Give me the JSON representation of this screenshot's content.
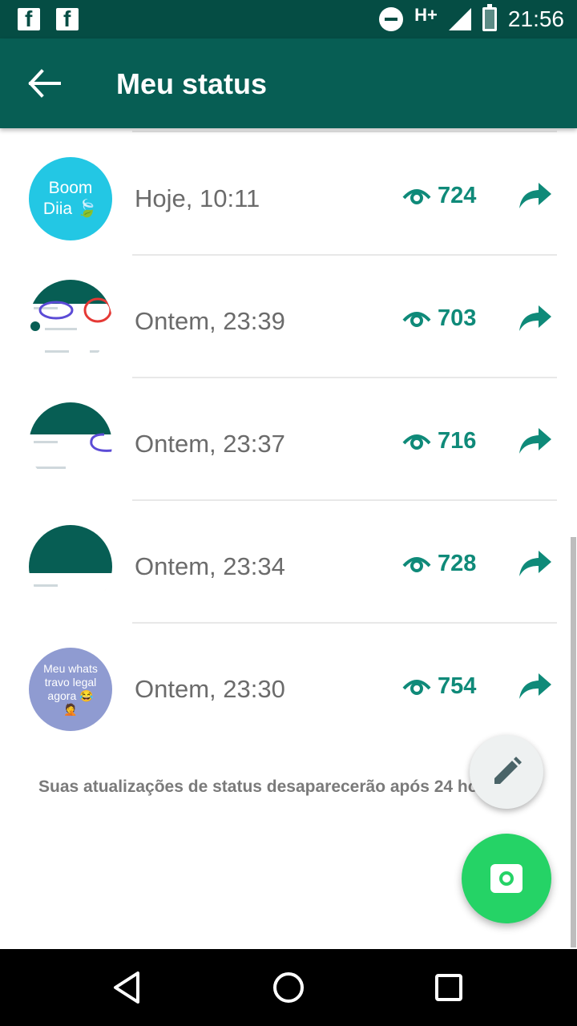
{
  "status_bar": {
    "time": "21:56",
    "network": "H+",
    "icons": [
      "facebook-icon",
      "facebook-icon",
      "do-not-disturb-icon",
      "signal-icon",
      "battery-icon"
    ]
  },
  "header": {
    "title": "Meu status",
    "back_icon": "arrow-left-icon"
  },
  "statuses": [
    {
      "time": "Hoje, 10:11",
      "views": "724",
      "thumb_lines": [
        "Boom",
        "Diia 🍃"
      ],
      "thumb_color": "#23c7e4"
    },
    {
      "time": "Ontem, 23:39",
      "views": "703"
    },
    {
      "time": "Ontem, 23:37",
      "views": "716"
    },
    {
      "time": "Ontem, 23:34",
      "views": "728"
    },
    {
      "time": "Ontem, 23:30",
      "views": "754",
      "thumb_lines": [
        "Meu whats",
        "travo legal",
        "agora 😂",
        "🤦"
      ],
      "thumb_color": "#8f9bd1"
    }
  ],
  "footer_note": "Suas atualizações de status desaparecerão após 24 horas.",
  "fabs": {
    "edit_icon": "pencil-icon",
    "camera_icon": "camera-icon"
  },
  "colors": {
    "primary": "#075e54",
    "status_bar": "#054d44",
    "accent": "#25d366",
    "views_teal": "#0f8a79"
  },
  "nav": [
    "back-triangle-icon",
    "home-circle-icon",
    "recents-square-icon"
  ]
}
